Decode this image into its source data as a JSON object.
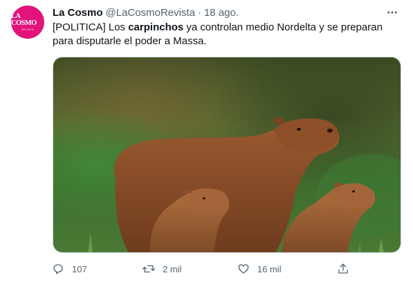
{
  "account": {
    "avatar_text": "LA COSMO",
    "avatar_subtext": "REVISTA",
    "name": "La Cosmo",
    "handle": "@LaCosmoRevista",
    "separator": "·",
    "time": "18 ago."
  },
  "tweet": {
    "text_before": "[POLITICA] Los ",
    "text_bold": "carpinchos",
    "text_after": " ya controlan medio Nordelta y se preparan para disputarle el poder a Massa."
  },
  "media": {
    "icon": "photo-capybaras"
  },
  "actions": {
    "reply": {
      "icon": "reply-icon",
      "count": "107"
    },
    "retweet": {
      "icon": "retweet-icon",
      "count": "2 mil"
    },
    "like": {
      "icon": "heart-icon",
      "count": "16 mil"
    },
    "share": {
      "icon": "share-icon"
    }
  },
  "colors": {
    "brand": "#e2147b",
    "muted": "#536471",
    "text": "#0f1419"
  }
}
